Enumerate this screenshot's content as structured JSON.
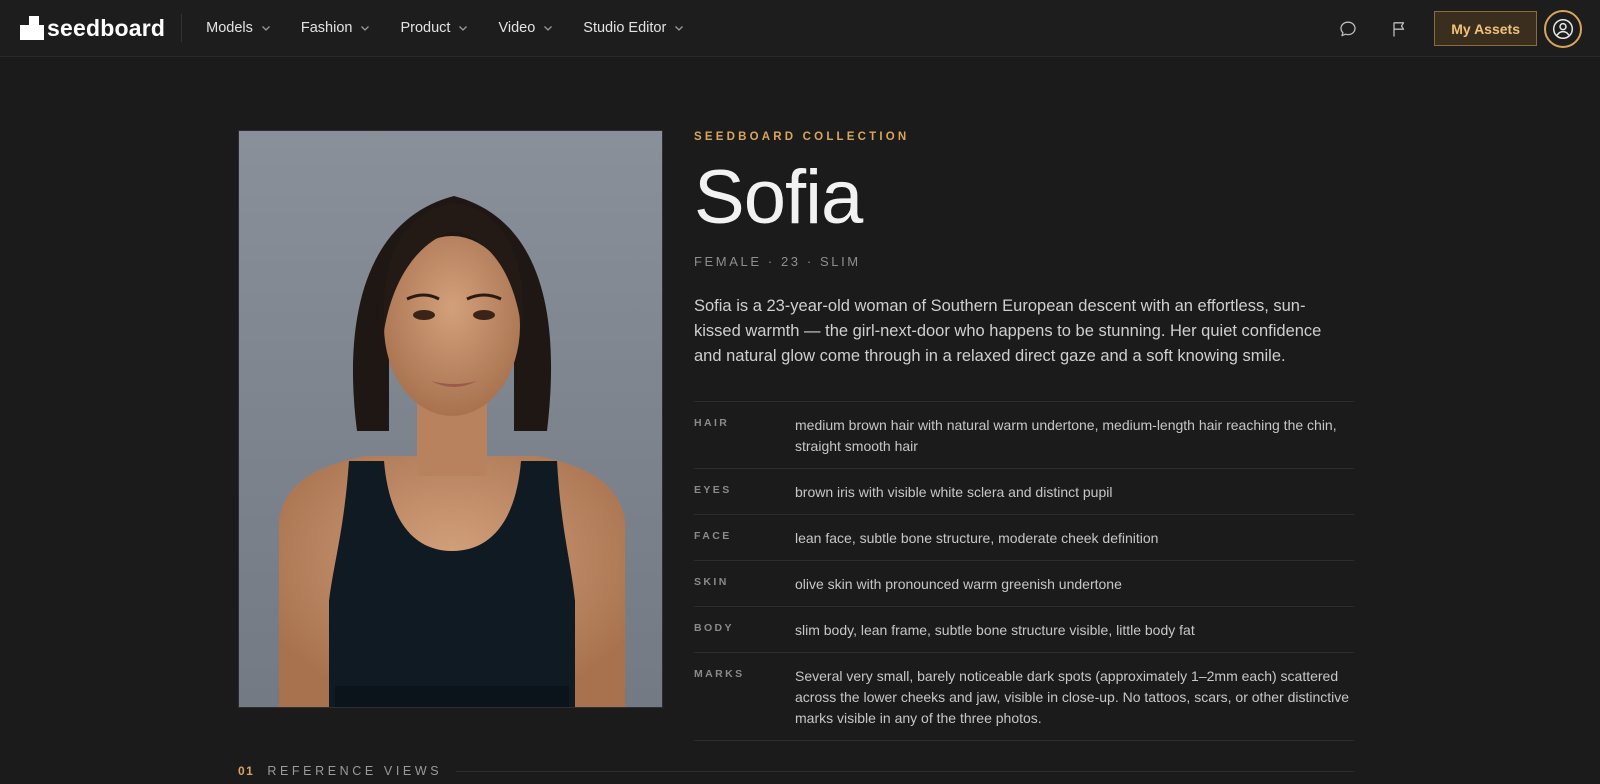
{
  "brand": {
    "name": "seedboard"
  },
  "nav": {
    "items": [
      {
        "label": "Models"
      },
      {
        "label": "Fashion"
      },
      {
        "label": "Product"
      },
      {
        "label": "Video"
      },
      {
        "label": "Studio Editor"
      }
    ]
  },
  "toolbar": {
    "icons": [
      "chat-bubble-icon",
      "flag-icon"
    ],
    "assets_label": "My Assets",
    "avatar_icon": "user-circle-icon"
  },
  "colors": {
    "accent": "#d9a55a",
    "background": "#1b1b1b",
    "text": "#e6e6e6"
  },
  "model": {
    "collection": "SEEDBOARD COLLECTION",
    "name": "Sofia",
    "meta": "FEMALE · 23 · SLIM",
    "bio": "Sofia is a 23-year-old woman of Southern European descent with an effortless, sun-kissed warmth — the girl-next-door who happens to be stunning. Her quiet confidence and natural glow come through in a relaxed direct gaze and a soft knowing smile.",
    "attributes": [
      {
        "key": "HAIR",
        "value": "medium brown hair with natural warm undertone, medium-length hair reaching the chin, straight smooth hair"
      },
      {
        "key": "EYES",
        "value": "brown iris with visible white sclera and distinct pupil"
      },
      {
        "key": "FACE",
        "value": "lean face, subtle bone structure, moderate cheek definition"
      },
      {
        "key": "SKIN",
        "value": "olive skin with pronounced warm greenish undertone"
      },
      {
        "key": "BODY",
        "value": "slim body, lean frame, subtle bone structure visible, little body fat"
      },
      {
        "key": "MARKS",
        "value": "Several very small, barely noticeable dark spots (approximately 1–2mm each) scattered across the lower cheeks and jaw, visible in close-up. No tattoos, scars, or other distinctive marks visible in any of the three photos."
      }
    ]
  },
  "section": {
    "number": "01",
    "title": "REFERENCE VIEWS"
  }
}
